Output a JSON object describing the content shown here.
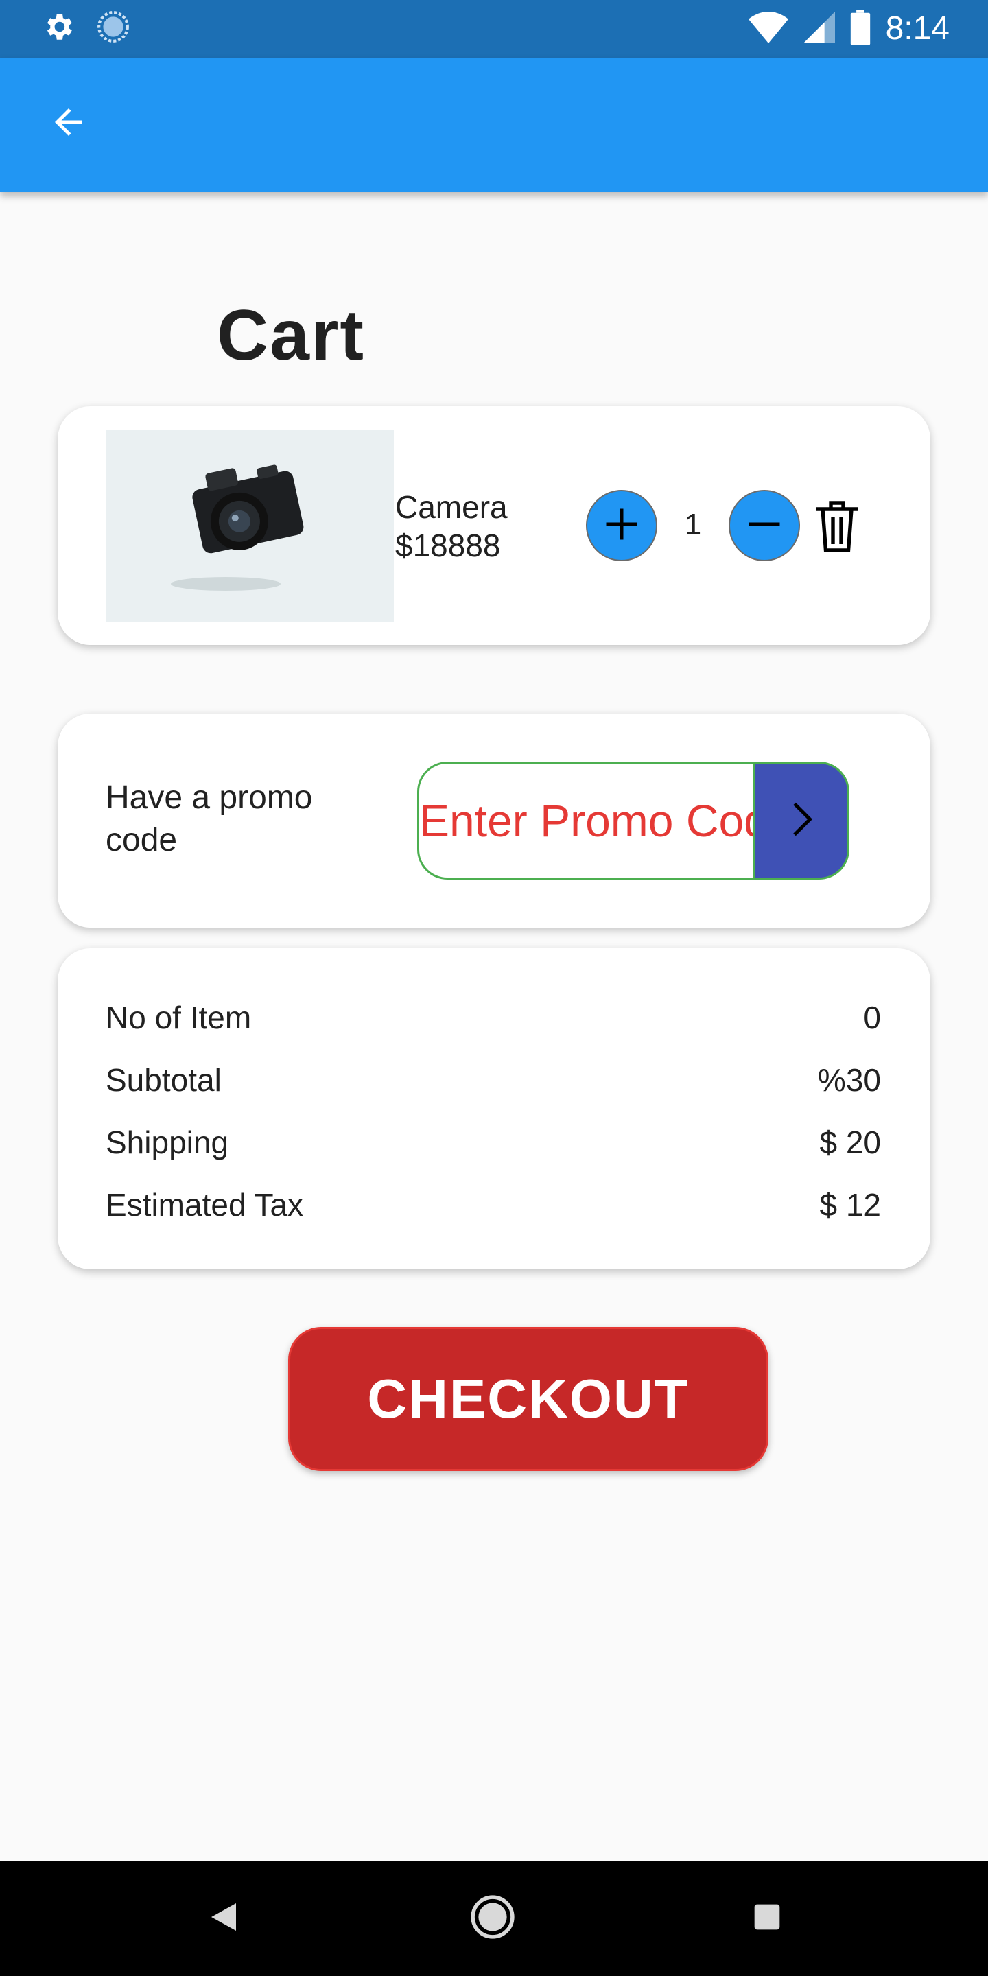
{
  "status_bar": {
    "time": "8:14",
    "left_icons": [
      "gear-icon",
      "sync-icon"
    ],
    "right_icons": [
      "wifi-icon",
      "signal-icon",
      "battery-icon"
    ]
  },
  "app_bar": {
    "back_icon": "arrow-left-icon",
    "color": "#2196f3"
  },
  "page": {
    "title": "Cart"
  },
  "cart_items": [
    {
      "name": "Camera",
      "price": "$18888",
      "quantity": "1",
      "image": "camera-photo"
    }
  ],
  "promo": {
    "label": "Have a promo code",
    "placeholder": "Enter Promo Code",
    "submit_icon": "chevron-right-icon"
  },
  "summary": {
    "rows": [
      {
        "label": "No of Item",
        "value": "0"
      },
      {
        "label": "Subtotal",
        "value": "%30"
      },
      {
        "label": "Shipping",
        "value": "$ 20"
      },
      {
        "label": "Estimated Tax",
        "value": "$ 12"
      }
    ]
  },
  "checkout": {
    "label": "CHECKOUT",
    "color": "#c62828"
  },
  "nav_bar": {
    "icons": [
      "back-triangle-icon",
      "home-circle-icon",
      "recents-square-icon"
    ]
  }
}
